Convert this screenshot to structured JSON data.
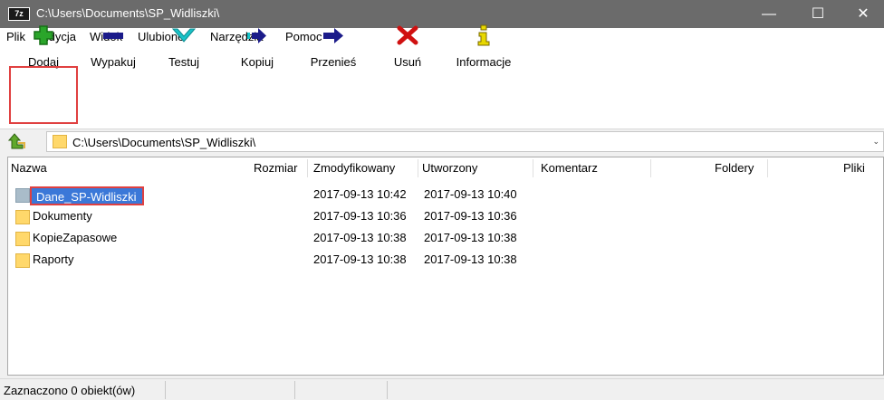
{
  "window": {
    "app_icon": "7z",
    "title": "C:\\Users\\Documents\\SP_Widliszki\\",
    "minimize_glyph": "—",
    "maximize_glyph": "☐",
    "close_glyph": "✕"
  },
  "menu": [
    "Plik",
    "Edycja",
    "Widok",
    "Ulubione",
    "Narzędzia",
    "Pomoc"
  ],
  "toolbar": {
    "add": {
      "label": "Dodaj",
      "icon": "plus-icon",
      "color": "#2aa52a"
    },
    "extract": {
      "label": "Wypakuj",
      "icon": "minus-icon",
      "color": "#1b1b8a"
    },
    "test": {
      "label": "Testuj",
      "icon": "check-icon",
      "color": "#19c3c8"
    },
    "copy": {
      "label": "Kopiuj",
      "icon": "copy-arrow-icon",
      "color": "#1b1b8a"
    },
    "move": {
      "label": "Przenieś",
      "icon": "move-arrow-icon",
      "color": "#1b1b8a"
    },
    "delete": {
      "label": "Usuń",
      "icon": "delete-x-icon",
      "color": "#d01010"
    },
    "info": {
      "label": "Informacje",
      "icon": "info-icon",
      "color": "#c8b400"
    }
  },
  "address": {
    "path": "C:\\Users\\Documents\\SP_Widliszki\\",
    "caret": "⌄"
  },
  "columns": {
    "name": "Nazwa",
    "size": "Rozmiar",
    "modified": "Zmodyfikowany",
    "created": "Utworzony",
    "comment": "Komentarz",
    "folders": "Foldery",
    "files": "Pliki"
  },
  "rows": [
    {
      "name": "Dane_SP-Widliszki",
      "modified": "2017-09-13 10:42",
      "created": "2017-09-13 10:40",
      "selected": true
    },
    {
      "name": "Dokumenty",
      "modified": "2017-09-13 10:36",
      "created": "2017-09-13 10:36"
    },
    {
      "name": "KopieZapasowe",
      "modified": "2017-09-13 10:38",
      "created": "2017-09-13 10:38"
    },
    {
      "name": "Raporty",
      "modified": "2017-09-13 10:38",
      "created": "2017-09-13 10:38"
    }
  ],
  "status": {
    "selection": "Zaznaczono 0 obiekt(ów)"
  },
  "colors": {
    "titlebar": "#6b6b6b",
    "selection": "#3b78d8",
    "highlight_frame": "#e04040",
    "folder": "#ffd86b"
  }
}
